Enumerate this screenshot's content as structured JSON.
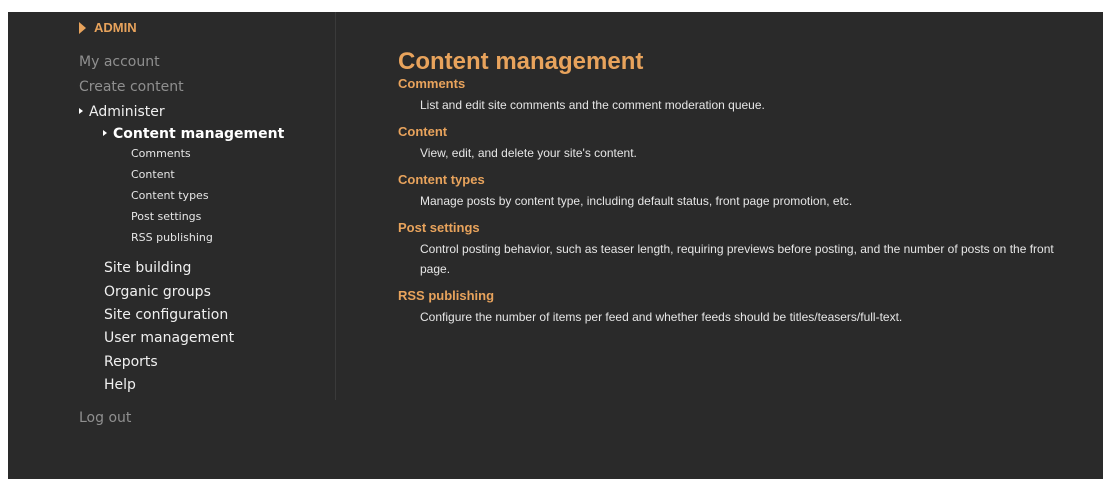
{
  "sidebar": {
    "header": "ADMIN",
    "my_account": "My account",
    "create_content": "Create content",
    "administer": "Administer",
    "content_management": "Content management",
    "sub_items": [
      "Comments",
      "Content",
      "Content types",
      "Post settings",
      "RSS publishing"
    ],
    "admin_items": [
      "Site building",
      "Organic groups",
      "Site configuration",
      "User management",
      "Reports",
      "Help"
    ],
    "log_out": "Log out"
  },
  "main": {
    "title": "Content management",
    "entries": [
      {
        "title": "Comments",
        "desc": "List and edit site comments and the comment moderation queue."
      },
      {
        "title": "Content",
        "desc": "View, edit, and delete your site's content."
      },
      {
        "title": "Content types",
        "desc": "Manage posts by content type, including default status, front page promotion, etc."
      },
      {
        "title": "Post settings",
        "desc": "Control posting behavior, such as teaser length, requiring previews before posting, and the number of posts on the front page."
      },
      {
        "title": "RSS publishing",
        "desc": "Configure the number of items per feed and whether feeds should be titles/teasers/full-text."
      }
    ]
  },
  "colors": {
    "background": "#2a2a2a",
    "accent": "#e8a35c",
    "muted_link": "#8f8f8f",
    "text": "#e6e6e6"
  }
}
